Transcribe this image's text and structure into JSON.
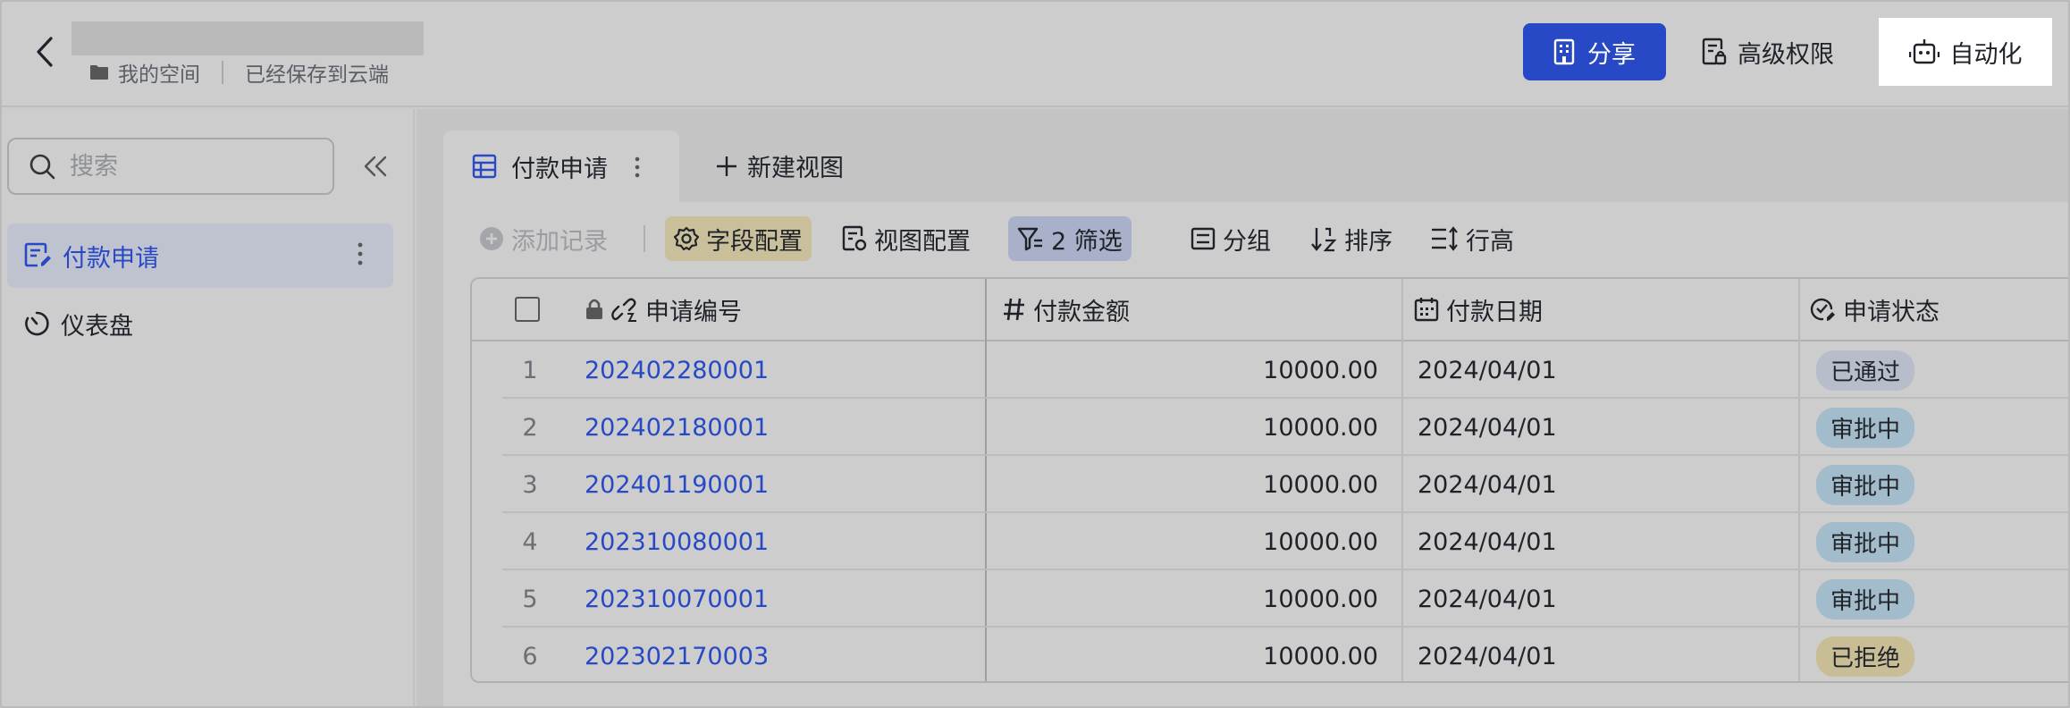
{
  "header": {
    "breadcrumb_space": "我的空间",
    "save_status": "已经保存到云端",
    "share_label": "分享",
    "permission_label": "高级权限",
    "automation_label": "自动化"
  },
  "sidebar": {
    "search_placeholder": "搜索",
    "items": [
      {
        "label": "付款申请"
      },
      {
        "label": "仪表盘"
      }
    ]
  },
  "tabs": {
    "active_label": "付款申请",
    "new_view_label": "新建视图"
  },
  "toolbar": {
    "add_record": "添加记录",
    "field_config": "字段配置",
    "view_config": "视图配置",
    "filter": "2 筛选",
    "group": "分组",
    "sort": "排序",
    "row_height": "行高"
  },
  "table": {
    "columns": [
      "申请编号",
      "付款金额",
      "付款日期",
      "申请状态"
    ],
    "rows": [
      {
        "index": "1",
        "id": "202402280001",
        "amount": "10000.00",
        "date": "2024/04/01",
        "status": "已通过"
      },
      {
        "index": "2",
        "id": "202402180001",
        "amount": "10000.00",
        "date": "2024/04/01",
        "status": "审批中"
      },
      {
        "index": "3",
        "id": "202401190001",
        "amount": "10000.00",
        "date": "2024/04/01",
        "status": "审批中"
      },
      {
        "index": "4",
        "id": "202310080001",
        "amount": "10000.00",
        "date": "2024/04/01",
        "status": "审批中"
      },
      {
        "index": "5",
        "id": "202310070001",
        "amount": "10000.00",
        "date": "2024/04/01",
        "status": "审批中"
      },
      {
        "index": "6",
        "id": "202302170003",
        "amount": "10000.00",
        "date": "2024/04/01",
        "status": "已拒绝"
      }
    ],
    "status_colors": {
      "已通过": "#b8bdcc",
      "审批中": "#a3bccb",
      "已拒绝": "#c9bd95"
    }
  },
  "colors": {
    "accent": "#2849c5",
    "background": "#cbcbcb"
  },
  "icons": {
    "back": "chevron-left-icon",
    "folder": "folder-icon",
    "share": "building-icon",
    "permission": "doc-lock-icon",
    "automation": "robot-icon",
    "search": "search-icon",
    "collapse": "double-chevron-left-icon",
    "form": "form-edit-icon",
    "dashboard": "dashboard-icon",
    "grid": "grid-icon",
    "plus": "plus-icon",
    "gear": "gear-icon",
    "filter": "filter-icon",
    "group": "group-icon",
    "sort": "sort-icon",
    "row_height": "row-height-icon",
    "lock": "lock-icon",
    "hash": "hash-icon",
    "calendar": "calendar-icon",
    "status": "status-icon"
  }
}
